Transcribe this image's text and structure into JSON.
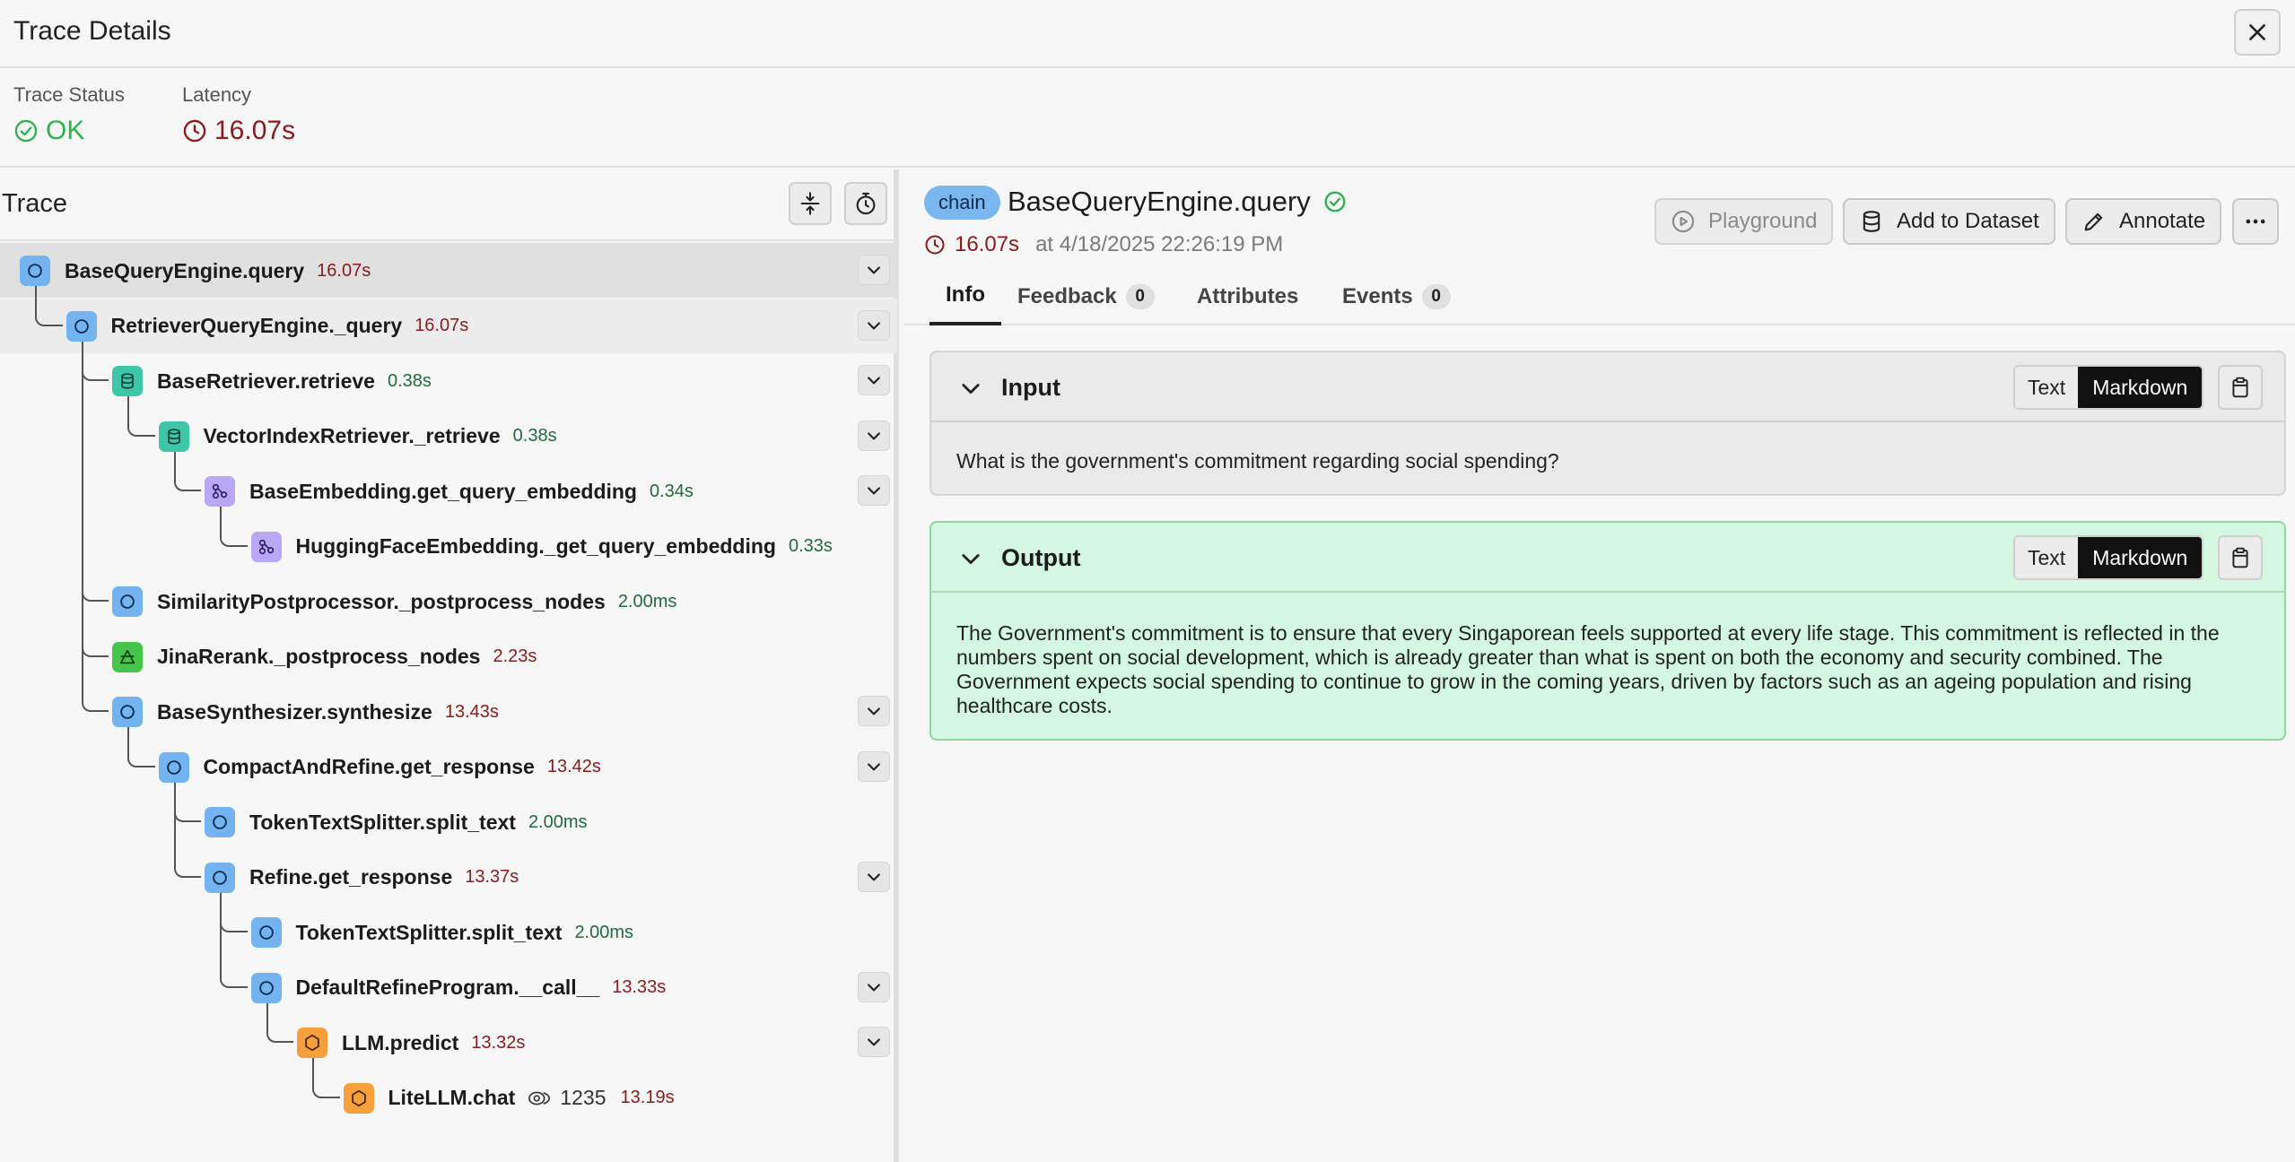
{
  "window": {
    "title": "Trace Details"
  },
  "status": {
    "trace_status_label": "Trace Status",
    "trace_status_value": "OK",
    "latency_label": "Latency",
    "latency_value": "16.07s"
  },
  "trace": {
    "title": "Trace",
    "nodes": [
      {
        "name": "BaseQueryEngine.query",
        "kind": "chain",
        "latency": "16.07s",
        "depth": 0,
        "expandable": true
      },
      {
        "name": "RetrieverQueryEngine._query",
        "kind": "chain",
        "latency": "16.07s",
        "depth": 1,
        "expandable": true
      },
      {
        "name": "BaseRetriever.retrieve",
        "kind": "retriever",
        "latency": "0.38s",
        "depth": 2,
        "expandable": true
      },
      {
        "name": "VectorIndexRetriever._retrieve",
        "kind": "retriever",
        "latency": "0.38s",
        "depth": 3,
        "expandable": true
      },
      {
        "name": "BaseEmbedding.get_query_embedding",
        "kind": "embedding",
        "latency": "0.34s",
        "depth": 4,
        "expandable": true
      },
      {
        "name": "HuggingFaceEmbedding._get_query_embedding",
        "kind": "embedding",
        "latency": "0.33s",
        "depth": 5,
        "expandable": false
      },
      {
        "name": "SimilarityPostprocessor._postprocess_nodes",
        "kind": "chain",
        "latency": "2.00ms",
        "depth": 2,
        "expandable": false
      },
      {
        "name": "JinaRerank._postprocess_nodes",
        "kind": "reranker",
        "latency": "2.23s",
        "depth": 2,
        "expandable": false
      },
      {
        "name": "BaseSynthesizer.synthesize",
        "kind": "chain",
        "latency": "13.43s",
        "depth": 2,
        "expandable": true
      },
      {
        "name": "CompactAndRefine.get_response",
        "kind": "chain",
        "latency": "13.42s",
        "depth": 3,
        "expandable": true
      },
      {
        "name": "TokenTextSplitter.split_text",
        "kind": "chain",
        "latency": "2.00ms",
        "depth": 4,
        "expandable": false
      },
      {
        "name": "Refine.get_response",
        "kind": "chain",
        "latency": "13.37s",
        "depth": 4,
        "expandable": true
      },
      {
        "name": "TokenTextSplitter.split_text",
        "kind": "chain",
        "latency": "2.00ms",
        "depth": 5,
        "expandable": false
      },
      {
        "name": "DefaultRefineProgram.__call__",
        "kind": "chain",
        "latency": "13.33s",
        "depth": 5,
        "expandable": true
      },
      {
        "name": "LLM.predict",
        "kind": "llm",
        "latency": "13.32s",
        "depth": 6,
        "expandable": true
      },
      {
        "name": "LiteLLM.chat",
        "kind": "llm",
        "latency": "13.19s",
        "depth": 7,
        "expandable": false,
        "tokens": "1235"
      }
    ]
  },
  "span": {
    "kind_chip": "chain",
    "name": "BaseQueryEngine.query",
    "latency": "16.07s",
    "timestamp": "at 4/18/2025 22:26:19 PM",
    "actions": {
      "playground": "Playground",
      "add_to_dataset": "Add to Dataset",
      "annotate": "Annotate"
    }
  },
  "tabs": [
    {
      "label": "Info",
      "count": ""
    },
    {
      "label": "Feedback",
      "count": "0"
    },
    {
      "label": "Attributes",
      "count": ""
    },
    {
      "label": "Events",
      "count": "0"
    }
  ],
  "input": {
    "title": "Input",
    "mode_text": "Text",
    "mode_markdown": "Markdown",
    "body": "What is the government's commitment regarding social spending?"
  },
  "output": {
    "title": "Output",
    "mode_text": "Text",
    "mode_markdown": "Markdown",
    "body": "The Government's commitment is to ensure that every Singaporean feels supported at every life stage. This commitment is reflected in the numbers spent on social development, which is already greater than what is spent on both the economy and security combined. The Government expects social spending to continue to grow in the coming years, driven by factors such as an ageing population and rising healthcare costs."
  },
  "colors": {
    "ok": "#2eb24d",
    "latency_slow": "#8b1a1a",
    "latency_fast": "#226a3d",
    "chain": "#72b3f0",
    "retriever": "#3ec6a8",
    "embedding": "#b8a8f5",
    "reranker": "#47c44a",
    "llm": "#f5a03a",
    "output_bg": "#d3f7e1"
  }
}
